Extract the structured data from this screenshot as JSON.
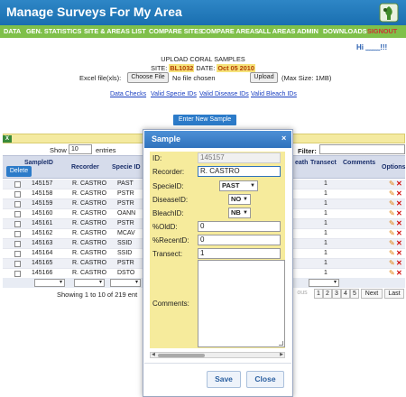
{
  "header": {
    "title": "Manage Surveys For My Area"
  },
  "nav": [
    {
      "label": "DATA"
    },
    {
      "label": "GEN. STATISTICS"
    },
    {
      "label": "SITE & AREAS LIST"
    },
    {
      "label": "COMPARE SITES"
    },
    {
      "label": "COMPARE AREAS"
    },
    {
      "label": "ALL AREAS"
    },
    {
      "label": "ADMIN"
    },
    {
      "label": "DOWNLOADS"
    },
    {
      "label": "SIGNOUT"
    }
  ],
  "greeting": "Hi ﹏﹏!!!",
  "upload": {
    "title": "UPLOAD CORAL SAMPLES",
    "site_label": "SITE:",
    "site_value": "BL1032",
    "date_label": "DATE:",
    "date_value": "Oct 05 2010",
    "excel_label": "Excel file(xls):",
    "choose_file": "Choose File",
    "no_file": "No file chosen",
    "upload_button": "Upload",
    "max_size": "(Max Size: 1MB)"
  },
  "links": [
    "Data Checks",
    "Valid Specie IDs",
    "Valid Disease IDs",
    "Valid Bleach IDs"
  ],
  "new_sample_button": "Enter New Sample",
  "table": {
    "show_label": "Show",
    "show_value": "10",
    "entries_label": "entries",
    "filter_label": "Filter:",
    "delete_button": "Delete",
    "columns": [
      "SampleID",
      "Recorder",
      "Specie ID",
      "eath",
      "Transect",
      "Comments",
      "Options"
    ],
    "rows": [
      {
        "id": "145157",
        "recorder": "R. CASTRO",
        "specie": "PAST",
        "transect": "1"
      },
      {
        "id": "145158",
        "recorder": "R. CASTRO",
        "specie": "PSTR",
        "transect": "1"
      },
      {
        "id": "145159",
        "recorder": "R. CASTRO",
        "specie": "PSTR",
        "transect": "1"
      },
      {
        "id": "145160",
        "recorder": "R. CASTRO",
        "specie": "OANN",
        "transect": "1"
      },
      {
        "id": "145161",
        "recorder": "R. CASTRO",
        "specie": "PSTR",
        "transect": "1"
      },
      {
        "id": "145162",
        "recorder": "R. CASTRO",
        "specie": "MCAV",
        "transect": "1"
      },
      {
        "id": "145163",
        "recorder": "R. CASTRO",
        "specie": "SSID",
        "transect": "1"
      },
      {
        "id": "145164",
        "recorder": "R. CASTRO",
        "specie": "SSID",
        "transect": "1"
      },
      {
        "id": "145165",
        "recorder": "R. CASTRO",
        "specie": "PSTR",
        "transect": "1"
      },
      {
        "id": "145166",
        "recorder": "R. CASTRO",
        "specie": "DSTO",
        "transect": "1"
      }
    ],
    "showing": "Showing 1 to 10 of 219 ent",
    "pagination": [
      "ous",
      "1",
      "2",
      "3",
      "4",
      "5",
      "Next",
      "Last"
    ]
  },
  "modal": {
    "title": "Sample",
    "close_symbol": "×",
    "fields": {
      "id_label": "ID:",
      "id_value": "145157",
      "recorder_label": "Recorder:",
      "recorder_value": "R. CASTRO",
      "specie_label": "SpecieID:",
      "specie_value": "PAST",
      "disease_label": "DiseaseID:",
      "disease_value": "NO",
      "bleach_label": "BleachID:",
      "bleach_value": "NB",
      "oldd_label": "%OldD:",
      "oldd_value": "0",
      "recentd_label": "%RecentD:",
      "recentd_value": "0",
      "transect_label": "Transect:",
      "transect_value": "1",
      "comments_label": "Comments:",
      "comments_value": ""
    },
    "save_button": "Save",
    "close_button": "Close"
  }
}
